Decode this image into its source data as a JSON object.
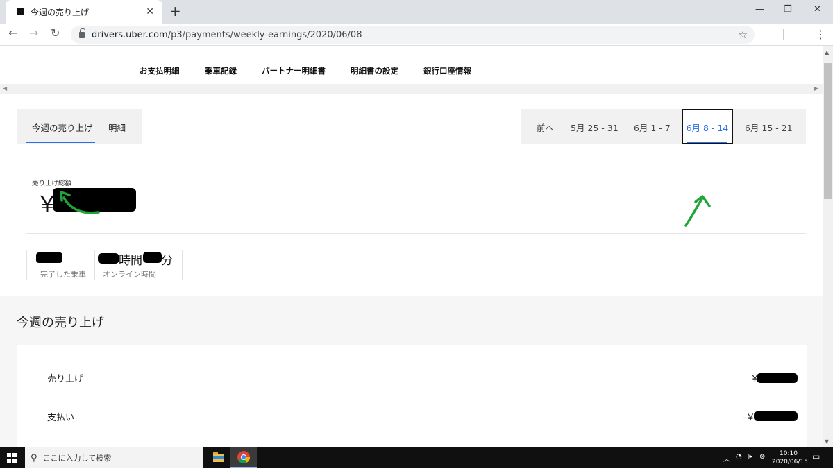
{
  "browser": {
    "tab_title": "今週の売り上げ",
    "tab_close": "✕",
    "new_tab": "+",
    "url_host": "drivers.uber.com",
    "url_path": "/p3/payments/weekly-earnings/2020/06/08",
    "win_min": "—",
    "win_max": "❐",
    "win_close": "✕"
  },
  "topnav": {
    "items": [
      "お支払明細",
      "乗車記録",
      "パートナー明細書",
      "明細書の設定",
      "銀行口座情報"
    ]
  },
  "segment": {
    "tabs": [
      "今週の売り上げ",
      "明細"
    ],
    "active_index": 0
  },
  "weeknav": {
    "prev": "前へ",
    "weeks": [
      "5月 25 - 31",
      "6月 1 - 7",
      "6月 8 - 14",
      "6月 15 - 21"
    ],
    "active": "6月 8 - 14"
  },
  "summary": {
    "total_label": "売り上げ総額",
    "total_currency": "￥",
    "trips_caption": "完了した乗車",
    "online_hours_unit": "時間",
    "online_minutes_unit": "分",
    "online_caption": "オンライン時間"
  },
  "breakdown": {
    "title": "今週の売り上げ",
    "rows": [
      {
        "label": "売り上げ",
        "value_prefix": "￥"
      },
      {
        "label": "支払い",
        "value_prefix": "-￥"
      }
    ]
  },
  "taskbar": {
    "search_placeholder": "ここに入力して検索",
    "time": "10:10",
    "date": "2020/06/15"
  },
  "colors": {
    "accent": "#276ef1",
    "annotation": "#1fa53a",
    "redaction": "#000000"
  }
}
